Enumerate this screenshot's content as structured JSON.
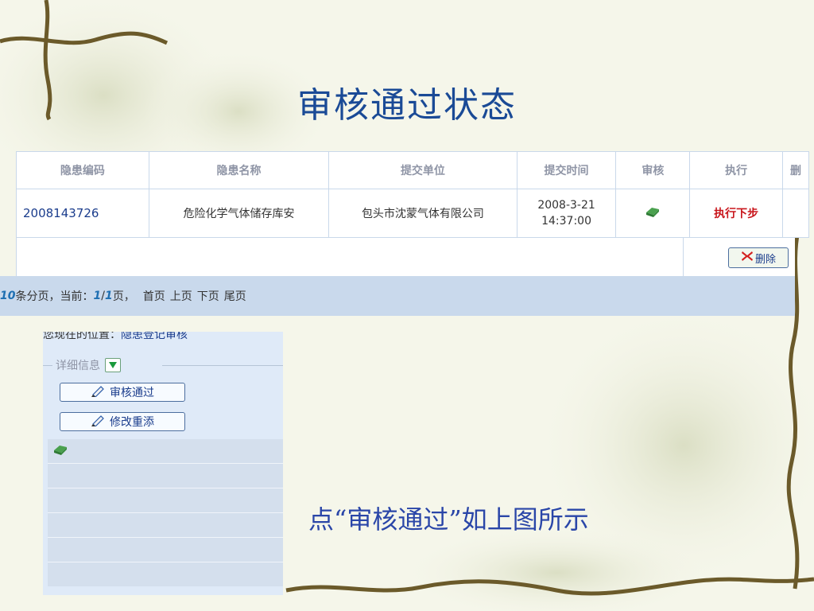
{
  "slide": {
    "title": "审核通过状态",
    "caption": "点“审核通过”如上图所示"
  },
  "grid": {
    "headers": [
      "隐患编码",
      "隐患名称",
      "提交单位",
      "提交时间",
      "审核",
      "执行",
      "删"
    ],
    "row": {
      "code": "2008143726",
      "name": "危险化学气体储存库安",
      "unit": "包头市沈蒙气体有限公司",
      "date": "2008-3-21",
      "time": "14:37:00",
      "approve_icon": "approved-icon",
      "execute": "执行下步"
    },
    "delete_button": "删除",
    "pager": {
      "count": "10",
      "per_page_text": "条分页，当前：",
      "current": "1",
      "slash": "/",
      "total": "1",
      "page_suffix": "页，",
      "first": "首页",
      "prev": "上页",
      "next": "下页",
      "last": "尾页"
    }
  },
  "detail": {
    "location_label": "您现在的位置：",
    "location_value": "隐患登记审核",
    "legend": "详细信息",
    "approve_button": "审核通过",
    "edit_button": "修改重添",
    "status_icon": "approved-icon"
  },
  "colors": {
    "title": "#1a4a96",
    "execute": "#c8141a",
    "pager_bg": "#c9d9ec"
  }
}
